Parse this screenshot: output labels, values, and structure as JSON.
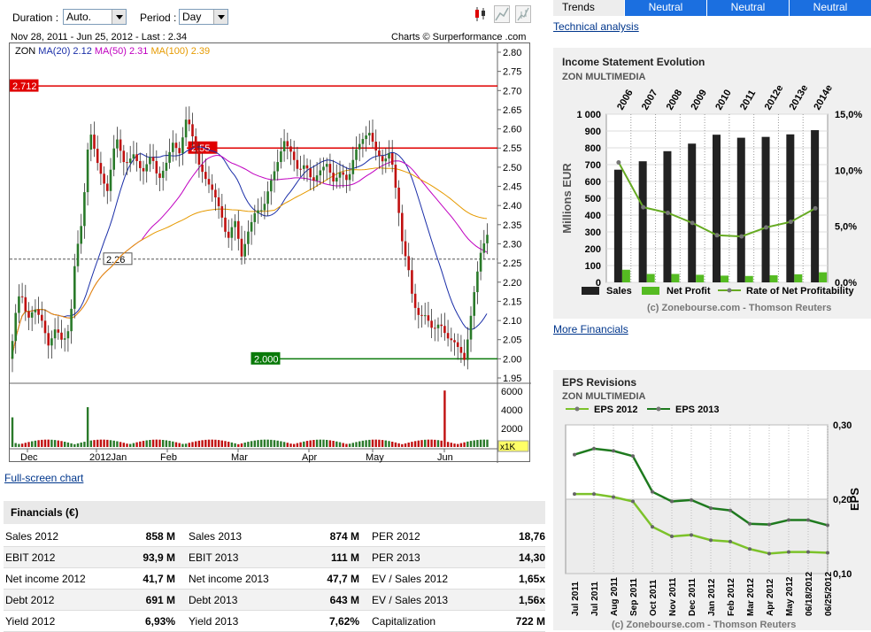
{
  "toolbar": {
    "duration_label": "Duration :",
    "duration_value": "Auto.",
    "period_label": "Period :",
    "period_value": "Day"
  },
  "chart_header": {
    "range": "Nov 28, 2011 - Jun 25, 2012 - Last : 2.34",
    "credit": "Charts © Surperformance .com"
  },
  "price_chart": {
    "legend_symbol": "ZON",
    "legend_ma20": "MA(20) 2.12",
    "legend_ma50": "MA(50) 2.31",
    "legend_ma100": "MA(100) 2.39",
    "colors": {
      "ma20": "#1a2ea8",
      "ma50": "#c000c0",
      "ma100": "#e69a00",
      "up": "#2a7a2a",
      "down": "#c01010"
    },
    "y_ticks": [
      "2.80",
      "2.75",
      "2.70",
      "2.65",
      "2.60",
      "2.55",
      "2.50",
      "2.45",
      "2.40",
      "2.35",
      "2.30",
      "2.25",
      "2.20",
      "2.15",
      "2.10",
      "2.05",
      "2.00",
      "1.95"
    ],
    "vol_ticks": [
      "6000",
      "4000",
      "2000"
    ],
    "vol_unit": "x1K",
    "x_labels": [
      "Dec",
      "2012Jan",
      "Feb",
      "Mar",
      "Apr",
      "May",
      "Jun"
    ],
    "levels": [
      {
        "value": 2.712,
        "label": "2.712",
        "color": "#e00000",
        "style": "solid"
      },
      {
        "value": 2.55,
        "label": "2.55",
        "color": "#e00000",
        "style": "solid"
      },
      {
        "value": 2.26,
        "label": "2.26",
        "color": "#555555",
        "style": "dashed"
      },
      {
        "value": 2.0,
        "label": "2.000",
        "color": "#0a7a0a",
        "style": "solid"
      }
    ]
  },
  "links": {
    "full_screen": "Full-screen chart",
    "technical_analysis": "Technical analysis",
    "more_financials": "More Financials"
  },
  "financials": {
    "title": "Financials (€)",
    "rows": [
      [
        [
          "Sales 2012",
          "858 M"
        ],
        [
          "Sales 2013",
          "874 M"
        ],
        [
          "PER 2012",
          "18,76"
        ]
      ],
      [
        [
          "EBIT 2012",
          "93,9 M"
        ],
        [
          "EBIT 2013",
          "111 M"
        ],
        [
          "PER 2013",
          "14,30"
        ]
      ],
      [
        [
          "Net income 2012",
          "41,7 M"
        ],
        [
          "Net income 2013",
          "47,7 M"
        ],
        [
          "EV / Sales 2012",
          "1,65x"
        ]
      ],
      [
        [
          "Debt 2012",
          "691 M"
        ],
        [
          "Debt 2013",
          "643 M"
        ],
        [
          "EV / Sales 2013",
          "1,56x"
        ]
      ],
      [
        [
          "Yield 2012",
          "6,93%"
        ],
        [
          "Yield 2013",
          "7,62%"
        ],
        [
          "Capitalization",
          "722 M"
        ]
      ]
    ]
  },
  "trends": {
    "label": "Trends",
    "values": [
      "Neutral",
      "Neutral",
      "Neutral"
    ],
    "colors": {
      "label_bg": "#ededed",
      "value_bg": "#1b6fe0"
    }
  },
  "income_statement": {
    "title": "Income Statement Evolution",
    "company": "ZON MULTIMEDIA",
    "credit": "(c) Zonebourse.com - Thomson Reuters",
    "chart_data": {
      "type": "bar",
      "categories": [
        "2006",
        "2007",
        "2008",
        "2009",
        "2010",
        "2011",
        "2012e",
        "2013e",
        "2014e"
      ],
      "series": [
        {
          "name": "Sales",
          "values": [
            670,
            720,
            780,
            825,
            878,
            860,
            865,
            880,
            905
          ],
          "color": "#222222"
        },
        {
          "name": "Net Profit",
          "values": [
            75,
            50,
            50,
            45,
            40,
            38,
            42,
            48,
            60
          ],
          "color": "#55bb22"
        },
        {
          "name": "Rate of Net Profitability",
          "values": [
            10.7,
            6.7,
            6.2,
            5.3,
            4.2,
            4.1,
            4.9,
            5.4,
            6.6
          ],
          "color": "#66aa22",
          "axis": "right"
        }
      ],
      "ylabel": "Millions EUR",
      "y_ticks": [
        "1 000",
        "900",
        "800",
        "700",
        "600",
        "500",
        "400",
        "300",
        "200",
        "100",
        "0"
      ],
      "ylim": [
        0,
        1000
      ],
      "y2_ticks": [
        "15,0%",
        "10,0%",
        "5,0%",
        "0,0%"
      ],
      "y2lim": [
        0,
        15
      ]
    }
  },
  "eps": {
    "title": "EPS Revisions",
    "company": "ZON MULTIMEDIA",
    "credit": "(c) Zonebourse.com - Thomson Reuters",
    "chart_data": {
      "type": "line",
      "x": [
        "Jul 2011",
        "Jul 2011",
        "Aug 2011",
        "Sep 2011",
        "Oct 2011",
        "Nov 2011",
        "Dec 2011",
        "Jan 2012",
        "Feb 2012",
        "Mar 2012",
        "Apr 2012",
        "May 2012",
        "06/18/2012",
        "06/25/2012"
      ],
      "series": [
        {
          "name": "EPS 2012",
          "values": [
            0.207,
            0.207,
            0.203,
            0.197,
            0.163,
            0.15,
            0.152,
            0.145,
            0.143,
            0.133,
            0.127,
            0.129,
            0.129,
            0.128
          ],
          "color": "#7cc22a"
        },
        {
          "name": "EPS 2013",
          "values": [
            0.26,
            0.268,
            0.265,
            0.258,
            0.21,
            0.197,
            0.199,
            0.188,
            0.185,
            0.167,
            0.166,
            0.172,
            0.172,
            0.165
          ],
          "color": "#1e7a1e"
        }
      ],
      "ylabel": "EPS",
      "y_ticks": [
        "0,30",
        "0,20",
        "0,10"
      ],
      "ylim": [
        0.1,
        0.3
      ]
    }
  }
}
